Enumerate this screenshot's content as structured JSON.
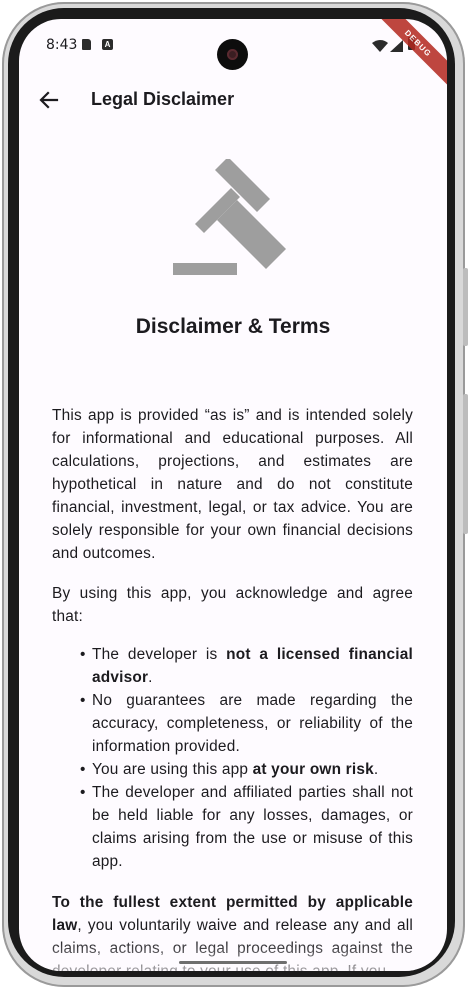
{
  "status_bar": {
    "time": "8:43",
    "icons": [
      "sd-card-icon",
      "accessibility-a-icon",
      "wifi-icon",
      "signal-icon",
      "battery-icon"
    ],
    "debug_banner": "DEBUG"
  },
  "app_bar": {
    "back_icon": "arrow-left-icon",
    "title": "Legal Disclaimer"
  },
  "content": {
    "hero_icon": "gavel-icon",
    "heading": "Disclaimer & Terms",
    "paragraph1": "This app is provided “as is” and is intended solely for informational and educational purposes. All calculations, projections, and estimates are hypothetical in nature and do not constitute financial, investment, legal, or tax advice. You are solely responsible for your own financial decisions and outcomes.",
    "paragraph2": "By using this app, you acknowledge and agree that:",
    "bullet_char": "•",
    "bullets": [
      {
        "before": "The developer is ",
        "bold": "not a licensed financial advisor",
        "after": "."
      },
      {
        "before": "No guarantees are made regarding the accuracy, completeness, or reliability of the information provided.",
        "bold": "",
        "after": ""
      },
      {
        "before": "You are using this app ",
        "bold": "at your own risk",
        "after": "."
      },
      {
        "before": "The developer and affiliated parties shall not be held liable for any losses, damages, or claims arising from the use or misuse of this app.",
        "bold": "",
        "after": ""
      }
    ],
    "paragraph3_bold": "To the fullest extent permitted by applicable law",
    "paragraph3_rest": ", you voluntarily waive and release any and all claims, actions, or legal proceedings against the developer relating to your use of this app. If you"
  },
  "colors": {
    "background": "#fefbff",
    "text": "#1c1b1f",
    "icon_gray": "#9e9e9e",
    "debug_banner": "#b3261e"
  }
}
